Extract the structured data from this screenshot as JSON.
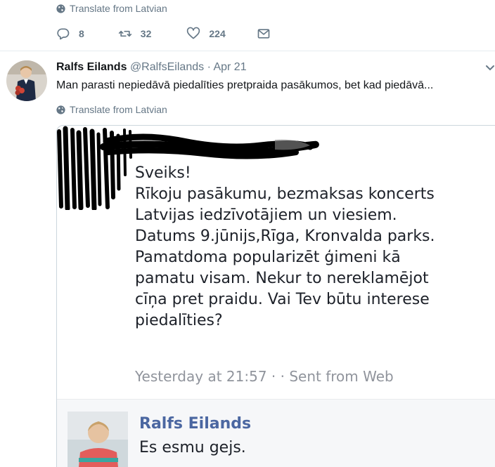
{
  "prev_tweet": {
    "translate_label": "Translate from Latvian",
    "actions": {
      "reply_count": "8",
      "retweet_count": "32",
      "like_count": "224"
    }
  },
  "tweet": {
    "author_name": "Ralfs Eilands",
    "handle": "@RalfsEilands",
    "separator": "·",
    "date": "Apr 21",
    "text": "Man parasti nepiedāvā piedalīties pretpraida pasākumos, bet kad piedāvā...",
    "translate_label": "Translate from Latvian"
  },
  "screenshot": {
    "message_lines": [
      "Sveiks!",
      "Rīkoju pasākumu, bezmaksas koncerts",
      "Latvijas iedzīvotājiem un viesiem.",
      "Datums 9.jūnijs,Rīga, Kronvalda parks.",
      "Pamatdoma popularizēt ģimeni kā",
      "pamatu visam. Nekur to nereklamējot",
      "cīņa pret praidu. Vai Tev būtu interese",
      "piedalīties?"
    ],
    "message_meta": "Yesterday at 21:57 · · Sent from Web",
    "reply_name": "Ralfs Eilands",
    "reply_text": "Es esmu gejs."
  },
  "icons": {
    "globe": "globe-icon",
    "reply": "reply-icon",
    "retweet": "retweet-icon",
    "like": "heart-icon",
    "dm": "envelope-icon",
    "caret": "chevron-down-icon"
  },
  "colors": {
    "secondary_text": "#657786",
    "facebook_name": "#4b67a1",
    "divider": "#e6ecf0"
  }
}
